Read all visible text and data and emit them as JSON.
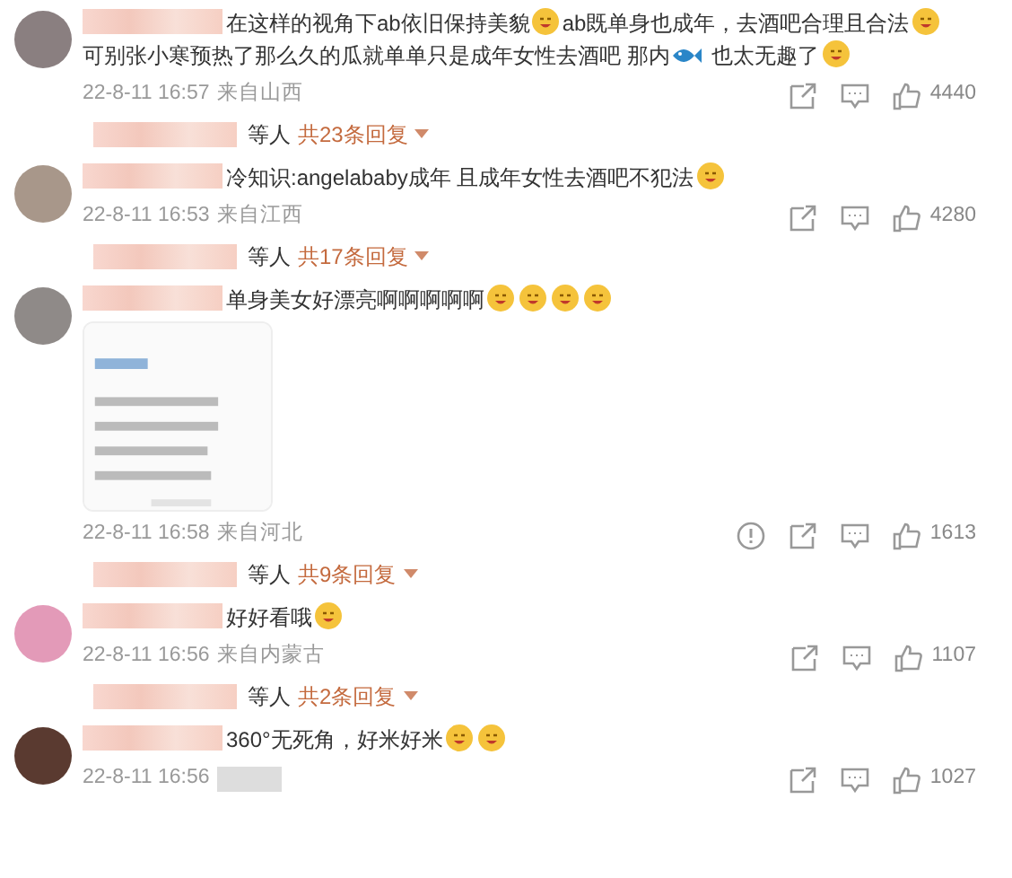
{
  "comments": [
    {
      "color": "#8a7f80",
      "content": [
        {
          "kind": "text",
          "text": "在这样的视角下ab依旧保持美貌"
        },
        {
          "kind": "emoji",
          "color": "#f5c33b"
        },
        {
          "kind": "text",
          "text": "ab既单身也成年，去酒吧合理且合法"
        },
        {
          "kind": "emoji",
          "color": "#f5c33b"
        },
        {
          "kind": "text",
          "text": "可别张小"
        },
        {
          "kind": "text",
          "text": "寒预热了那么久的瓜就单单只是成年女性去酒吧 那内"
        },
        {
          "kind": "fish"
        },
        {
          "kind": "text",
          "text": " 也太无趣了"
        },
        {
          "kind": "emoji",
          "color": "#f5c33b"
        }
      ],
      "time": "22-8-11 16:57",
      "location": "来自山西",
      "report": false,
      "likes": "4440",
      "replies_who": "等人",
      "replies": "共23条回复"
    },
    {
      "color": "#a8978a",
      "content": [
        {
          "kind": "text",
          "text": "冷知识:angelababy成年 且成年女性去酒吧不犯法"
        },
        {
          "kind": "emoji",
          "color": "#f5c33b"
        }
      ],
      "time": "22-8-11 16:53",
      "location": "来自江西",
      "report": false,
      "likes": "4280",
      "replies_who": "等人",
      "replies": "共17条回复"
    },
    {
      "color": "#8f8a88",
      "content": [
        {
          "kind": "text",
          "text": "单身美女好漂亮啊啊啊啊啊"
        },
        {
          "kind": "emoji",
          "color": "#f5c33b"
        },
        {
          "kind": "emoji",
          "color": "#f5c33b"
        },
        {
          "kind": "emoji",
          "color": "#f5c33b"
        },
        {
          "kind": "emoji",
          "color": "#f5c33b"
        }
      ],
      "time": "22-8-11 16:58",
      "location": "来自河北",
      "report": true,
      "likes": "1613",
      "replies_who": "等人",
      "replies": "共9条回复"
    },
    {
      "color": "#e39ab8",
      "content": [
        {
          "kind": "text",
          "text": "好好看哦"
        },
        {
          "kind": "emoji",
          "color": "#f5c33b"
        }
      ],
      "time": "22-8-11 16:56",
      "location": "来自内蒙古",
      "report": false,
      "likes": "1107",
      "replies_who": "等人",
      "replies": "共2条回复"
    },
    {
      "color": "#5a3a30",
      "content": [
        {
          "kind": "text",
          "text": "360°无死角，好米好米"
        },
        {
          "kind": "emoji",
          "color": "#f5c33b"
        },
        {
          "kind": "emoji",
          "color": "#f5c33b"
        }
      ],
      "time": "22-8-11 16:56",
      "location_hidden": true,
      "report": false,
      "likes": "1027"
    }
  ]
}
